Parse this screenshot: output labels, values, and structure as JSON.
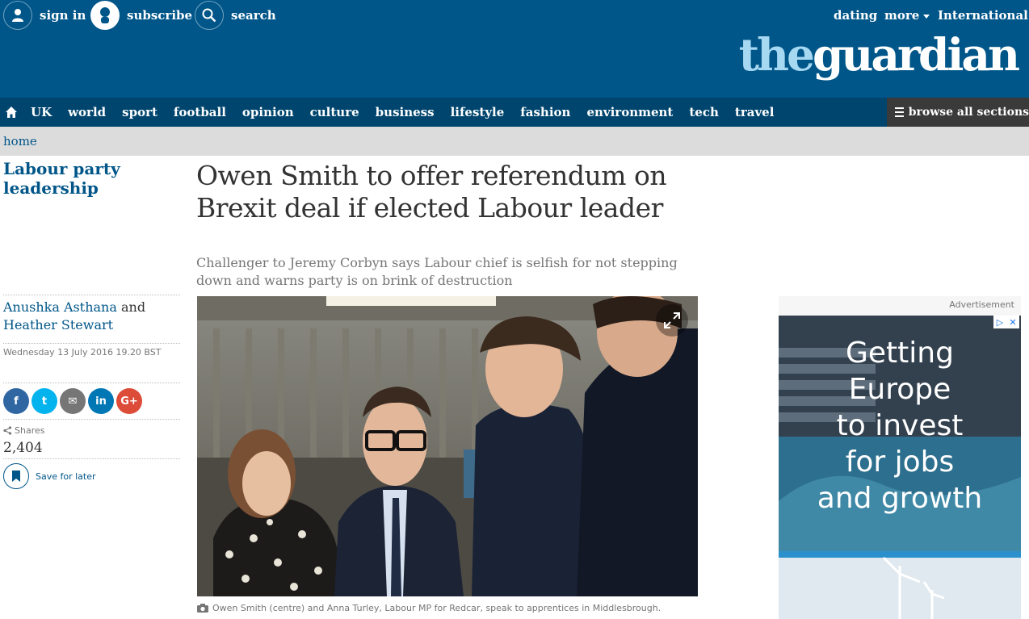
{
  "topbar": {
    "sign_in": "sign in",
    "subscribe": "subscribe",
    "search": "search",
    "dating": "dating",
    "more": "more",
    "international": "International"
  },
  "logo": {
    "the": "the",
    "guardian": "guardian"
  },
  "nav": {
    "items": [
      "UK",
      "world",
      "sport",
      "football",
      "opinion",
      "culture",
      "business",
      "lifestyle",
      "fashion",
      "environment",
      "tech",
      "travel"
    ],
    "browse": "browse all sections"
  },
  "breadcrumb": {
    "home": "home"
  },
  "article": {
    "series": "Labour party leadership",
    "headline": "Owen Smith to offer referendum on Brexit deal if elected Labour leader",
    "standfirst": "Challenger to Jeremy Corbyn says Labour chief is selfish for not stepping down and warns party is on brink of destruction",
    "authors": [
      "Anushka Asthana",
      "Heather Stewart"
    ],
    "author_joiner": "and",
    "date": "Wednesday 13 July 2016 19.20 BST",
    "shares_label": "Shares",
    "shares_count": "2,404",
    "save_label": "Save for later",
    "caption": "Owen Smith (centre) and Anna Turley, Labour MP for Redcar, speak to apprentices in Middlesbrough."
  },
  "share_buttons": [
    {
      "label": "f",
      "color": "#3067a3"
    },
    {
      "label": "t",
      "color": "#03b3ee"
    },
    {
      "label": "✉",
      "color": "#767676"
    },
    {
      "label": "in",
      "color": "#0077b5"
    },
    {
      "label": "G+",
      "color": "#dd4b39"
    }
  ],
  "advert": {
    "label": "Advertisement",
    "text_lines": [
      "Getting",
      "Europe",
      "to invest",
      "for jobs",
      "and growth"
    ]
  },
  "colors": {
    "brand_blue": "#005689",
    "nav_blue": "#00456e",
    "logo_light": "#a7d8f2"
  }
}
